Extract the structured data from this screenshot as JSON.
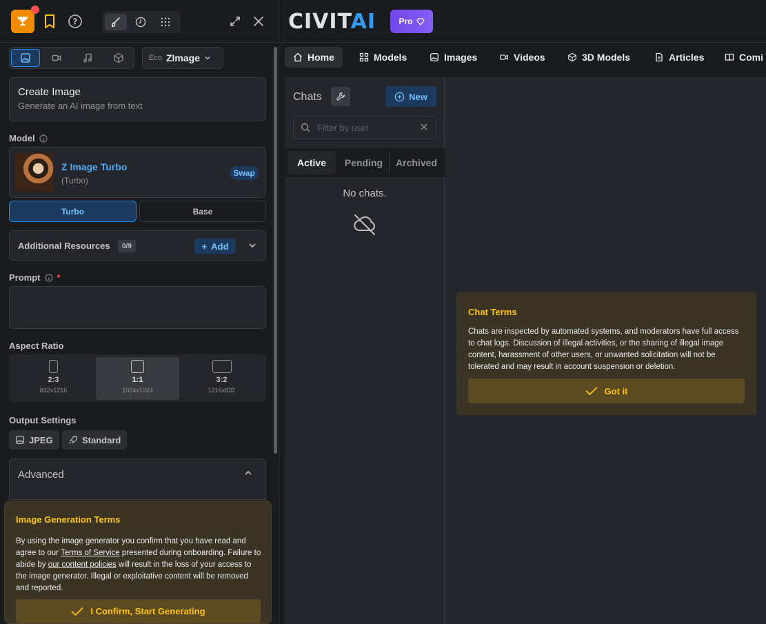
{
  "generator": {
    "media_tabs": [
      "image-icon",
      "video-icon",
      "audio-icon",
      "3d-cube-icon"
    ],
    "model_select": {
      "prefix": "Eco",
      "value": "ZImage"
    },
    "create": {
      "title": "Create Image",
      "subtitle": "Generate an AI image from text"
    },
    "model": {
      "label": "Model",
      "name": "Z Image Turbo",
      "variant": "(Turbo)",
      "swap_label": "Swap",
      "modes": [
        "Turbo",
        "Base"
      ],
      "selected_mode": "Turbo"
    },
    "resources": {
      "title": "Additional Resources",
      "count": "0/9",
      "add_label": "Add"
    },
    "prompt": {
      "label": "Prompt",
      "required_mark": "*",
      "value": ""
    },
    "aspect": {
      "label": "Aspect Ratio",
      "options": [
        {
          "ratio": "2:3",
          "dims": "832x1216"
        },
        {
          "ratio": "1:1",
          "dims": "1024x1024"
        },
        {
          "ratio": "3:2",
          "dims": "1216x832"
        }
      ],
      "selected": "1:1"
    },
    "output": {
      "label": "Output Settings",
      "format": "JPEG",
      "quality": "Standard"
    },
    "advanced": {
      "title": "Advanced"
    },
    "terms": {
      "title": "Image Generation Terms",
      "body_1": "By using the image generator you confirm that you have read and agree to our ",
      "tos_link": "Terms of Service",
      "body_2": " presented during onboarding. Failure to abide by ",
      "policy_link": "our content policies",
      "body_3": " will result in the loss of your access to the image generator. Illegal or exploitative content will be removed and reported.",
      "confirm_label": "I Confirm, Start Generating"
    }
  },
  "header": {
    "logo_main": "CIVIT",
    "logo_accent": "AI",
    "pro_label": "Pro"
  },
  "nav": {
    "home": "Home",
    "models": "Models",
    "images": "Images",
    "videos": "Videos",
    "models_3d": "3D Models",
    "articles": "Articles",
    "comics": "Comi"
  },
  "chat": {
    "title": "Chats",
    "new_label": "New",
    "filter_placeholder": "Filter by user",
    "tabs": [
      "Active",
      "Pending",
      "Archived"
    ],
    "active_tab": "Active",
    "empty": "No chats.",
    "terms": {
      "title": "Chat Terms",
      "body": "Chats are inspected by automated systems, and moderators have full access to chat logs. Discussion of illegal activities, or the sharing of illegal image content, harassment of other users, or unwanted solicitation will not be tolerated and may result in account suspension or deletion.",
      "button": "Got it"
    }
  },
  "colors": {
    "accent_blue": "#4dabf7",
    "warning_yellow": "#fcc419",
    "pro_purple": "#7048e8",
    "trophy_orange": "#f08c00"
  }
}
